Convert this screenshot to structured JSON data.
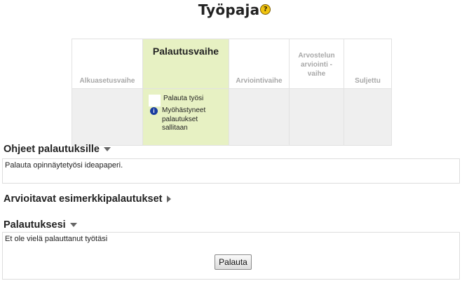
{
  "page": {
    "title": "Työpaja",
    "help_icon": "help-icon"
  },
  "phases": [
    {
      "label": "Alkuasetusvaihe",
      "active": false
    },
    {
      "label": "Palautusvaihe",
      "active": true
    },
    {
      "label": "Arviointivaihe",
      "active": false
    },
    {
      "label": "Arvostelun arviointi -vaihe",
      "active": false
    },
    {
      "label": "Suljettu",
      "active": false
    }
  ],
  "tasks": [
    {
      "text": "Palauta työsi",
      "icon": "checkbox-icon"
    },
    {
      "text": "Myöhästyneet palautukset sallitaan",
      "icon": "info-icon"
    }
  ],
  "sections": {
    "instructions": {
      "heading": "Ohjeet palautuksille",
      "body": "Palauta opinnäytetyösi ideapaperi."
    },
    "examples": {
      "heading": "Arvioitavat esimerkkipalautukset"
    },
    "your_submission": {
      "heading": "Palautuksesi",
      "body": "Et ole vielä palauttanut työtäsi",
      "button": "Palauta"
    }
  },
  "colors": {
    "active_phase_bg": "#e7f1c3",
    "inactive_cell_bg": "#efefef",
    "inactive_text": "#a8a8a8"
  }
}
